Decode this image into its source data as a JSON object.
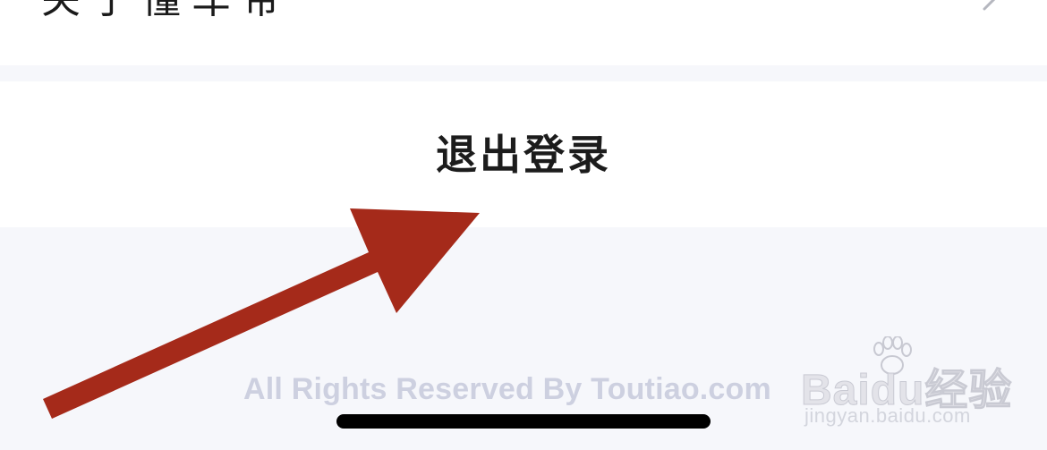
{
  "settings": {
    "about_label": "关于懂车帝",
    "logout_label": "退出登录"
  },
  "footer": {
    "copyright": "All Rights Reserved By Toutiao.com"
  },
  "watermark": {
    "logo_text": "Baidu经验",
    "url": "jingyan.baidu.com"
  },
  "colors": {
    "background": "#f6f7fb",
    "row_background": "#ffffff",
    "annotation_arrow": "#a52a1a",
    "copyright_text": "#cdd0e0"
  },
  "icons": {
    "row_chevron": "chevron-right-icon",
    "annotation": "arrow-annotation-icon",
    "watermark_mark": "paw-icon"
  }
}
